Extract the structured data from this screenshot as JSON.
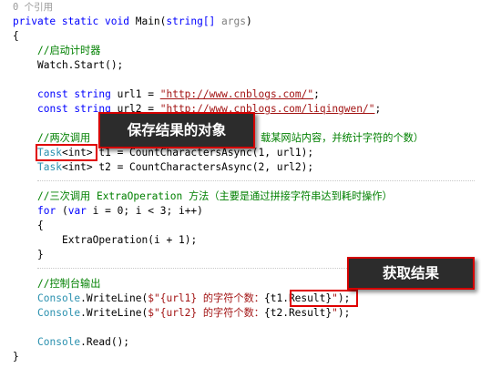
{
  "codelens": "0 个引用",
  "method_signature": {
    "modifiers": "private static void",
    "name": " Main(",
    "param_type": "string[]",
    "param_name": "args",
    "close": ")"
  },
  "lines": {
    "open_brace": "{",
    "comment_start_timer": "//启动计时器",
    "watch_start": "Watch.Start();",
    "url1": {
      "kw": "const",
      "type": " string",
      "rest": " url1 = ",
      "str": "\"http://www.cnblogs.com/\"",
      "end": ";"
    },
    "url2": {
      "kw": "const",
      "type": " string",
      "rest": " url2 = ",
      "str": "\"http://www.cnblogs.com/liqingwen/\"",
      "end": ";"
    },
    "comment_call_twice_a": "//两次调用",
    "comment_call_twice_b": "载某网站内容，并统计字符的个数）",
    "task1": {
      "type": "Task",
      "generic": "<int>",
      "rest": " t1 = CountCharactersAsync(1, url1);"
    },
    "task2": {
      "type": "Task",
      "generic": "<int>",
      "rest": " t2 = CountCharactersAsync(2, url2);"
    },
    "comment_three_calls": "//三次调用 ExtraOperation 方法（主要是通过拼接字符串达到耗时操作）",
    "for_loop": {
      "kw1": "for",
      "rest1": " (",
      "kw2": "var",
      "rest2": " i = 0; i < 3; i++)"
    },
    "inner_open_brace": "{",
    "extra_operation": "ExtraOperation(i + 1);",
    "inner_close_brace": "}",
    "comment_console_output": "//控制台输出",
    "writeline1": {
      "type": "Console",
      "rest": ".WriteLine(",
      "str_a": "$\"{url1} 的字符个数：",
      "expr": "{t1.Result}",
      "str_b": "\"",
      "end": ");"
    },
    "writeline2": {
      "type": "Console",
      "rest": ".WriteLine(",
      "str_a": "$\"{url2} 的字符个数：",
      "expr": "{t2.Result}",
      "str_b": "\"",
      "end": ");"
    },
    "console_read": {
      "type": "Console",
      "rest": ".Read();"
    },
    "close_brace": "}"
  },
  "annotations": {
    "save_result_object": "保存结果的对象",
    "get_result": "获取结果"
  },
  "colors": {
    "keyword": "#0000ff",
    "type": "#2b91af",
    "string": "#a31515",
    "comment": "#008000",
    "highlight": "#e00000",
    "callout_bg": "#2c2c2c"
  }
}
